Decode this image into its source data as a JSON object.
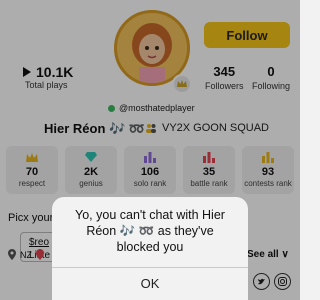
{
  "header": {
    "follow_label": "Follow"
  },
  "stats": {
    "plays_value": "10.1K",
    "plays_label": "Total plays",
    "followers_value": "345",
    "followers_label": "Followers",
    "following_value": "0",
    "following_label": "Following"
  },
  "profile": {
    "handle": "@mosthatedplayer",
    "display_name": "Hier Réon 🎶 ➿",
    "team_name": "VY2X GOON SQUAD",
    "online_color": "#3cb95f"
  },
  "cards": [
    {
      "icon": "crown-icon",
      "value": "70",
      "label": "respect",
      "color": "#e6b520"
    },
    {
      "icon": "diamond-icon",
      "value": "2K",
      "label": "genius",
      "color": "#2fc4b2"
    },
    {
      "icon": "bars-icon",
      "value": "106",
      "label": "solo rank",
      "color": "#8e6cd8"
    },
    {
      "icon": "bars-icon",
      "value": "35",
      "label": "battle rank",
      "color": "#e0434f"
    },
    {
      "icon": "bars-icon",
      "value": "93",
      "label": "contests rank",
      "color": "#e6b520"
    }
  ],
  "picks": {
    "title_partial": "Picx your",
    "card_line1": "$reo",
    "card_line2": "Liste",
    "see_all": "See all ∨",
    "location": "NZ"
  },
  "dialog": {
    "message": "Yo, you can't chat with Hier Réon 🎶 ➿ as they've blocked you",
    "ok_label": "OK"
  },
  "colors": {
    "accent": "#f5c518",
    "overlay": "rgba(0,0,0,0.32)"
  }
}
